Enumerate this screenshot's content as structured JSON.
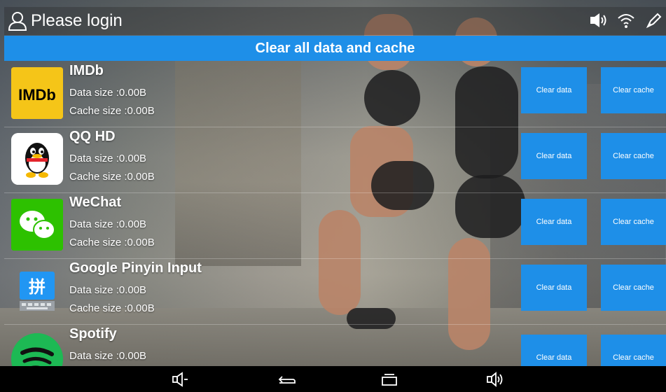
{
  "status_bar": {
    "login_text": "Please login",
    "icons": [
      "user-icon",
      "volume-icon",
      "wifi-icon",
      "brush-icon"
    ]
  },
  "clear_all_label": "Clear all data and cache",
  "apps": [
    {
      "name": "IMDb",
      "data_size": "Data size :0.00B",
      "cache_size": "Cache size :0.00B",
      "icon": "imdb-icon",
      "clear_data": "Clear data",
      "clear_cache": "Clear cache"
    },
    {
      "name": "QQ HD",
      "data_size": "Data size :0.00B",
      "cache_size": "Cache size :0.00B",
      "icon": "qq-icon",
      "clear_data": "Clear data",
      "clear_cache": "Clear cache"
    },
    {
      "name": "WeChat",
      "data_size": "Data size :0.00B",
      "cache_size": "Cache size :0.00B",
      "icon": "wechat-icon",
      "clear_data": "Clear data",
      "clear_cache": "Clear cache"
    },
    {
      "name": "Google Pinyin Input",
      "data_size": "Data size :0.00B",
      "cache_size": "Cache size :0.00B",
      "icon": "pinyin-icon",
      "clear_data": "Clear data",
      "clear_cache": "Clear cache"
    },
    {
      "name": "Spotify",
      "data_size": "Data size :0.00B",
      "cache_size": "",
      "icon": "spotify-icon",
      "clear_data": "Clear data",
      "clear_cache": "Clear cache"
    }
  ],
  "nav_bar": {
    "icons": [
      "volume-down-icon",
      "back-icon",
      "recents-icon",
      "volume-up-icon"
    ]
  },
  "colors": {
    "accent": "#1e8fe8",
    "text": "#ffffff",
    "nav_bg": "#000000"
  }
}
